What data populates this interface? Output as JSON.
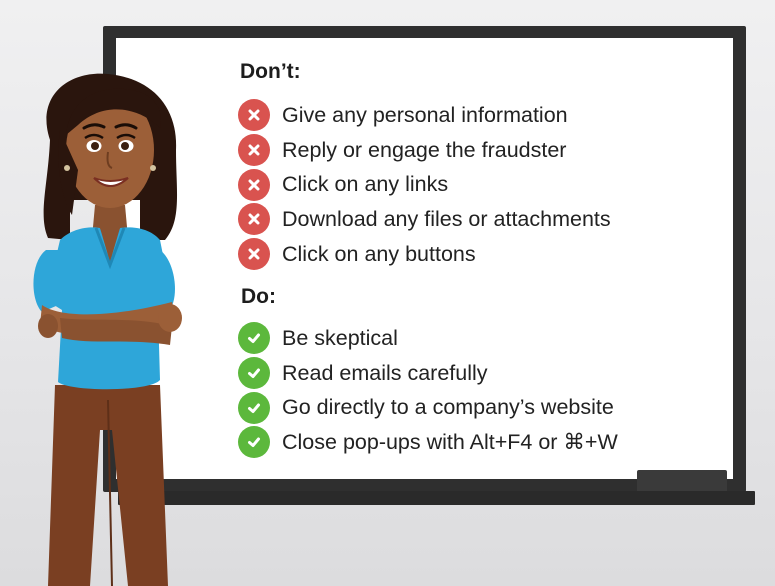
{
  "dont": {
    "heading": "Don’t:",
    "items": [
      "Give any personal information",
      "Reply or engage the fraudster",
      "Click on any links",
      "Download any files or attachments",
      "Click on any buttons"
    ],
    "icon": "x-circle-icon",
    "color": "#d9534f"
  },
  "do": {
    "heading": "Do:",
    "items": [
      "Be skeptical",
      "Read emails carefully",
      "Go directly to a company’s website",
      "Close pop-ups with Alt+F4 or ⌘+W"
    ],
    "icon": "check-circle-icon",
    "color": "#5cb83c"
  },
  "colors": {
    "board_frame": "#2f2f2f",
    "board_surface": "#ffffff",
    "shirt": "#2ea6d9",
    "pants": "#7a3f22"
  }
}
